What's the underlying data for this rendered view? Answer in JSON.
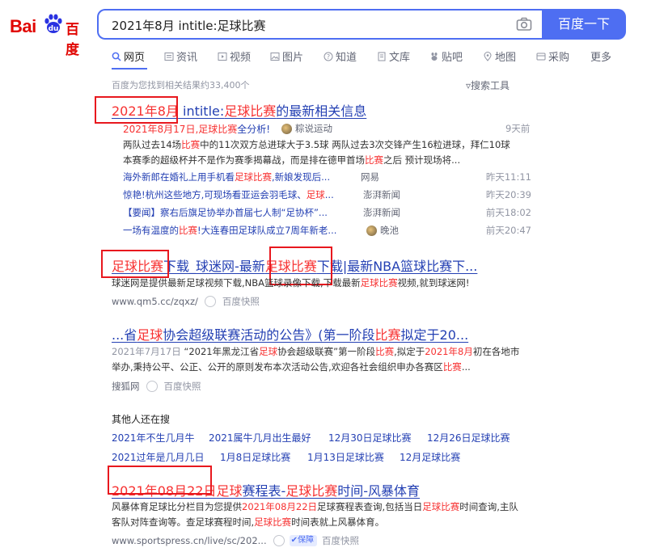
{
  "header": {
    "logo_text_bai": "Bai",
    "logo_text_du": "百度",
    "query": "2021年8月 intitle:足球比赛",
    "search_button": "百度一下"
  },
  "tabs": [
    {
      "label": "网页",
      "icon": "search-icon",
      "active": true
    },
    {
      "label": "资讯",
      "icon": "news-icon"
    },
    {
      "label": "视频",
      "icon": "video-icon"
    },
    {
      "label": "图片",
      "icon": "image-icon"
    },
    {
      "label": "知道",
      "icon": "question-icon"
    },
    {
      "label": "文库",
      "icon": "document-icon"
    },
    {
      "label": "贴吧",
      "icon": "tieba-icon"
    },
    {
      "label": "地图",
      "icon": "map-icon"
    },
    {
      "label": "采购",
      "icon": "cart-icon"
    },
    {
      "label": "更多",
      "icon": ""
    }
  ],
  "result_count": "百度为您找到相关结果约33,400个",
  "search_tools": "搜索工具",
  "result1": {
    "title_a": "2021年8月",
    "title_b": " intitle:",
    "title_c": "足球比赛",
    "title_d": "的最新相关信息",
    "sub_head_a": "2021年8月17日,",
    "sub_head_b": "足球比赛",
    "sub_head_c": "全分析!",
    "sub_source": "粽说运动",
    "sub_time": "9天前",
    "snippet_line1": "两队过去14场比赛中的11次双方总进球大于3.5球 两队过去3次交锋产生16粒进球，拜仁10球",
    "snippet_line2": "本赛季的超级杯并不是作为赛季揭幕战，而是排在德甲首场比赛之后 预计现场将...",
    "news": [
      {
        "a": "海外新郎在婚礼上用手机看",
        "b": "足球比赛",
        "c": ",新娘发现后...",
        "source": "网易",
        "time": "昨天11:11"
      },
      {
        "a": "惊艳!杭州这些地方,可现场看亚运会羽毛球、",
        "b": "足球",
        "c": "...",
        "source": "澎湃新闻",
        "time": "昨天20:39"
      },
      {
        "a": "【要闻】察右后旗足协举办首届七人制“足协杯”",
        "b": "",
        "c": "...",
        "source": "澎湃新闻",
        "time": "前天18:02"
      },
      {
        "a": "一场有温度的",
        "b": "比赛",
        "c": "!大连春田足球队成立7周年新老...",
        "source": "晚池",
        "time": "前天20:47"
      }
    ]
  },
  "result2": {
    "title_a": "足球比赛",
    "title_b": "下载_球迷网-最新",
    "title_c": "足球比赛",
    "title_d": "下载|最新NBA篮球比赛下...",
    "snippet_a": "球迷网是提供最新足球视频下载,NBA篮球录像下载,下载最新",
    "snippet_b": "足球比赛",
    "snippet_c": "视频,就到球迷网!",
    "url": "www.qm5.cc/zqxz/",
    "snapshot": "百度快照"
  },
  "result3": {
    "title_a": "...省",
    "title_b": "足球",
    "title_c": "协会超级联赛活动的公告》(第一阶段",
    "title_d": "比赛",
    "title_e": "拟定于20...",
    "date": "2021年7月17日",
    "snippet_line1_a": " “2021年黑龙江省",
    "snippet_line1_b": "足球",
    "snippet_line1_c": "协会超级联赛”第一阶段",
    "snippet_line1_d": "比赛",
    "snippet_line1_e": ",拟定于",
    "snippet_line1_f": "2021年8月",
    "snippet_line1_g": "初在各地市",
    "snippet_line2_a": "举办,秉持公平、公正、公开的原则发布本次活动公告,欢迎各社会组织申办各赛区",
    "snippet_line2_b": "比赛",
    "snippet_line2_c": "...",
    "source": "搜狐网",
    "snapshot": "百度快照"
  },
  "related": {
    "heading": "其他人还在搜",
    "row1": [
      "2021年不生几月牛",
      "2021属牛几月出生最好",
      "12月30日足球比赛",
      "12月26日足球比赛"
    ],
    "row2": [
      "2021过年是几月几日",
      "1月8日足球比赛",
      "1月13日足球比赛",
      "12月足球比赛"
    ]
  },
  "result4": {
    "title_a": "2021年08月22日",
    "title_b": "足球",
    "title_c": "赛程表-",
    "title_d": "足球比赛",
    "title_e": "时间-风暴体育",
    "snippet_line1_a": "风暴体育足球比分栏目为您提供",
    "snippet_line1_b": "2021年08月22日",
    "snippet_line1_c": "足球赛程表查询,包括当日",
    "snippet_line1_d": "足球比赛",
    "snippet_line1_e": "时间查询,主队",
    "snippet_line2_a": "客队对阵查询等。查足球赛程时间,",
    "snippet_line2_b": "足球比赛",
    "snippet_line2_c": "时间表就上风暴体育。",
    "url": "www.sportspress.cn/live/sc/202...",
    "badge": "保障",
    "snapshot": "百度快照"
  }
}
